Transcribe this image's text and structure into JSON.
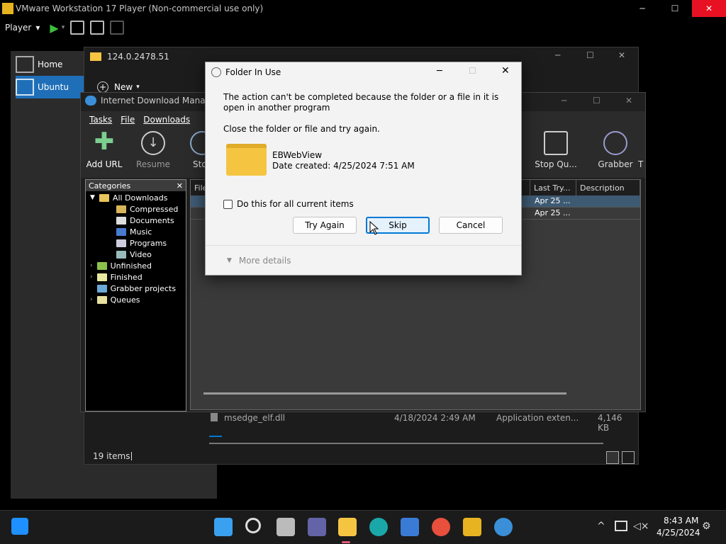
{
  "vmware": {
    "title": "VMware Workstation 17 Player (Non-commercial use only)",
    "player_label": "Player",
    "library": [
      {
        "label": "Home"
      },
      {
        "label": "Ubuntu"
      }
    ]
  },
  "explorer": {
    "title": "124.0.2478.51",
    "new_label": "New",
    "file_row": {
      "name": "msedge_elf.dll",
      "date": "4/18/2024 2:49 AM",
      "type": "Application exten...",
      "size": "4,146 KB"
    },
    "status": "19 items"
  },
  "idm": {
    "title": "Internet Download Manage",
    "menu": [
      "Tasks",
      "File",
      "Downloads"
    ],
    "tools": [
      "Add URL",
      "Resume",
      "Sto",
      "Stop Qu...",
      "Grabber",
      "T"
    ],
    "categories_title": "Categories",
    "tree": [
      "All Downloads",
      "Compressed",
      "Documents",
      "Music",
      "Programs",
      "Video",
      "Unfinished",
      "Finished",
      "Grabber projects",
      "Queues"
    ],
    "columns": [
      "File",
      "Last Try...",
      "Description"
    ],
    "rows": [
      {
        "last_try": "Apr 25 ..."
      },
      {
        "last_try": "Apr 25 ..."
      }
    ]
  },
  "dialog": {
    "title": "Folder In Use",
    "message": "The action can't be completed because the folder or a file in it is open in another program",
    "instruction": "Close the folder or file and try again.",
    "item_name": "EBWebView",
    "item_date": "Date created: 4/25/2024 7:51 AM",
    "checkbox_label": "Do this for all current items",
    "buttons": {
      "try_again": "Try Again",
      "skip": "Skip",
      "cancel": "Cancel"
    },
    "more_details": "More details"
  },
  "taskbar": {
    "time": "8:43 AM",
    "date": "4/25/2024"
  },
  "colors": {
    "accent": "#0078d4",
    "close_red": "#e81123",
    "folder": "#f5c542"
  }
}
